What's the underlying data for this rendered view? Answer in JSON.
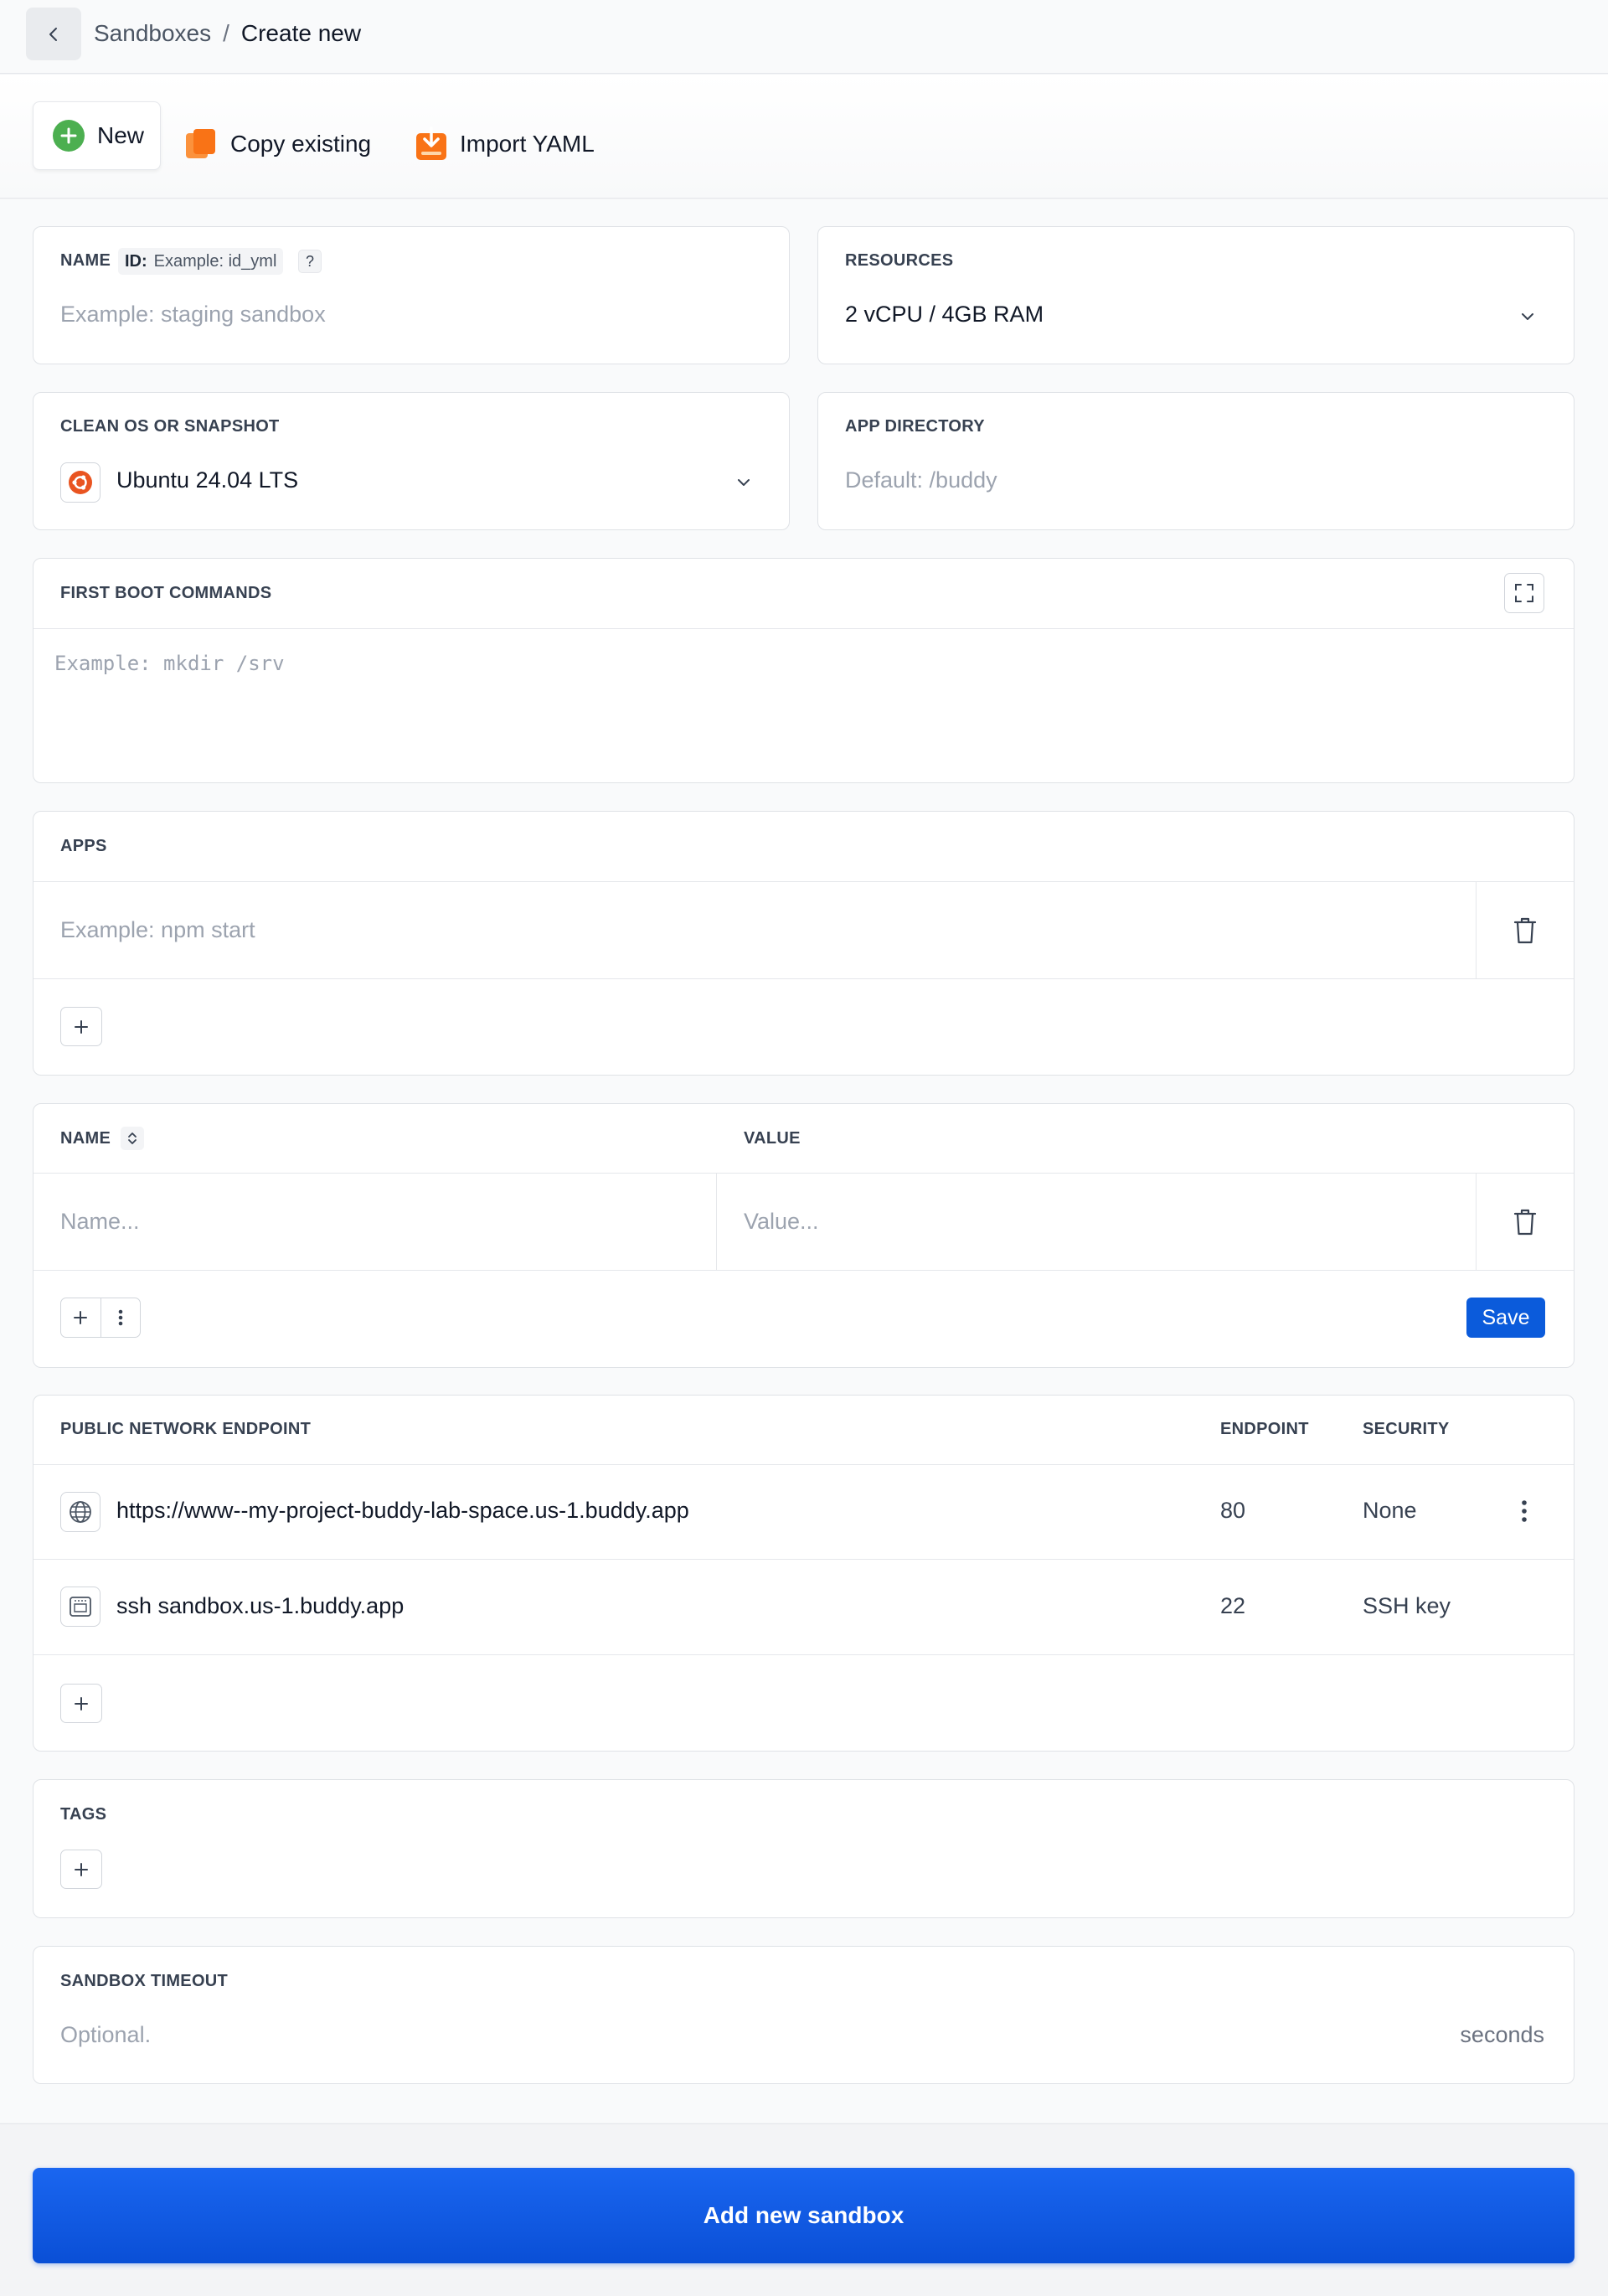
{
  "breadcrumb": {
    "parent": "Sandboxes",
    "separator": "/",
    "current": "Create new"
  },
  "modes": {
    "new": "New",
    "copy": "Copy existing",
    "import": "Import YAML"
  },
  "name_field": {
    "label": "NAME",
    "id_label": "ID:",
    "id_placeholder": "Example: id_yml",
    "help": "?",
    "placeholder": "Example: staging sandbox"
  },
  "resources": {
    "label": "RESOURCES",
    "value": "2 vCPU / 4GB RAM"
  },
  "os": {
    "label": "CLEAN OS OR SNAPSHOT",
    "value": "Ubuntu 24.04 LTS"
  },
  "app_dir": {
    "label": "APP DIRECTORY",
    "placeholder": "Default: /buddy"
  },
  "first_boot": {
    "label": "FIRST BOOT COMMANDS",
    "placeholder": "Example: mkdir /srv"
  },
  "apps": {
    "label": "APPS",
    "placeholder": "Example: npm start"
  },
  "env": {
    "name_header": "NAME",
    "value_header": "VALUE",
    "name_placeholder": "Name...",
    "value_placeholder": "Value...",
    "save": "Save"
  },
  "endpoints": {
    "header": "PUBLIC NETWORK ENDPOINT",
    "col_endpoint": "ENDPOINT",
    "col_security": "SECURITY",
    "rows": [
      {
        "address": "https://www--my-project-buddy-lab-space.us-1.buddy.app",
        "port": "80",
        "security": "None",
        "icon": "globe-icon"
      },
      {
        "address": "ssh sandbox.us-1.buddy.app",
        "port": "22",
        "security": "SSH key",
        "icon": "terminal-icon"
      }
    ]
  },
  "tags": {
    "label": "TAGS"
  },
  "timeout": {
    "label": "SANDBOX TIMEOUT",
    "placeholder": "Optional.",
    "unit": "seconds"
  },
  "submit": "Add new sandbox",
  "colors": {
    "primary": "#0b5bdb",
    "ubuntu": "#e95420",
    "new_icon": "#4caf50",
    "copy_icon": "#f97316"
  }
}
